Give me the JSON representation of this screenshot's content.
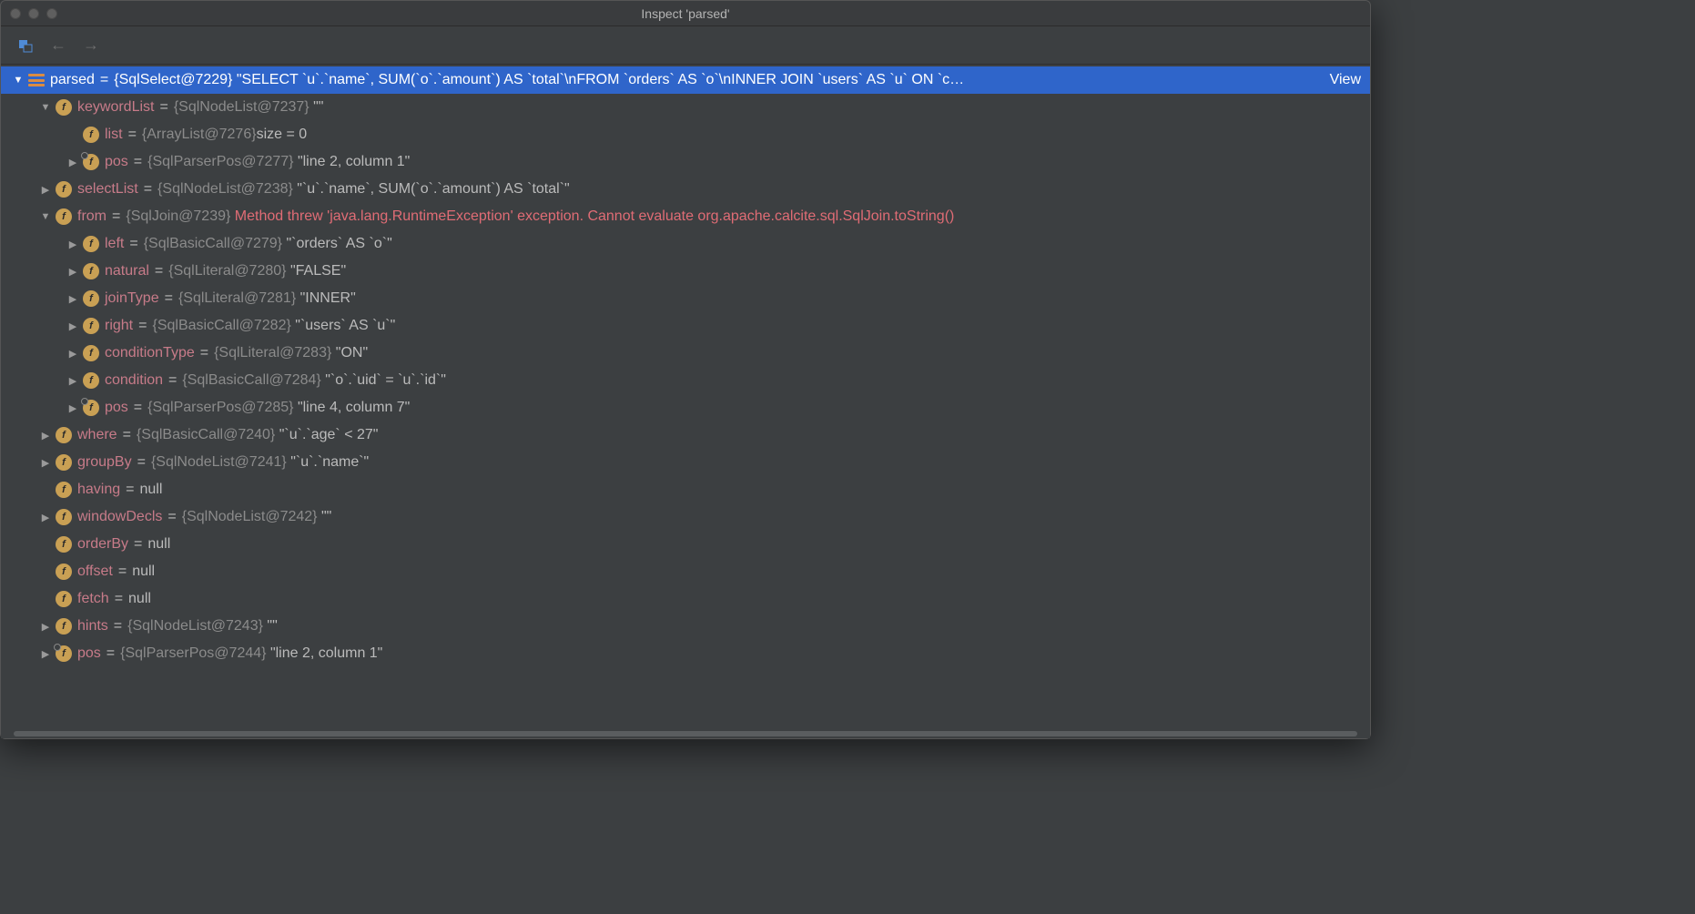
{
  "window": {
    "title": "Inspect 'parsed'"
  },
  "root": {
    "name": "parsed",
    "type": "{SqlSelect@7229}",
    "value": "\"SELECT `u`.`name`, SUM(`o`.`amount`) AS `total`\\nFROM `orders` AS `o`\\nINNER JOIN `users` AS `u` ON `c…",
    "viewLabel": "View"
  },
  "nodes": {
    "keywordList": {
      "name": "keywordList",
      "type": "{SqlNodeList@7237}",
      "value": "\"\""
    },
    "list": {
      "name": "list",
      "type": "{ArrayList@7276}",
      "value": " size = 0"
    },
    "pos1": {
      "name": "pos",
      "type": "{SqlParserPos@7277}",
      "value": "\"line 2, column 1\""
    },
    "selectList": {
      "name": "selectList",
      "type": "{SqlNodeList@7238}",
      "value": "\"`u`.`name`, SUM(`o`.`amount`) AS `total`\""
    },
    "from": {
      "name": "from",
      "type": "{SqlJoin@7239}",
      "value": "Method threw 'java.lang.RuntimeException' exception. Cannot evaluate org.apache.calcite.sql.SqlJoin.toString()"
    },
    "left": {
      "name": "left",
      "type": "{SqlBasicCall@7279}",
      "value": "\"`orders` AS `o`\""
    },
    "natural": {
      "name": "natural",
      "type": "{SqlLiteral@7280}",
      "value": "\"FALSE\""
    },
    "joinType": {
      "name": "joinType",
      "type": "{SqlLiteral@7281}",
      "value": "\"INNER\""
    },
    "right": {
      "name": "right",
      "type": "{SqlBasicCall@7282}",
      "value": "\"`users` AS `u`\""
    },
    "conditionType": {
      "name": "conditionType",
      "type": "{SqlLiteral@7283}",
      "value": "\"ON\""
    },
    "condition": {
      "name": "condition",
      "type": "{SqlBasicCall@7284}",
      "value": "\"`o`.`uid` = `u`.`id`\""
    },
    "pos2": {
      "name": "pos",
      "type": "{SqlParserPos@7285}",
      "value": "\"line 4, column 7\""
    },
    "where": {
      "name": "where",
      "type": "{SqlBasicCall@7240}",
      "value": "\"`u`.`age` < 27\""
    },
    "groupBy": {
      "name": "groupBy",
      "type": "{SqlNodeList@7241}",
      "value": "\"`u`.`name`\""
    },
    "having": {
      "name": "having",
      "type": "",
      "value": "null"
    },
    "windowDecls": {
      "name": "windowDecls",
      "type": "{SqlNodeList@7242}",
      "value": "\"\""
    },
    "orderBy": {
      "name": "orderBy",
      "type": "",
      "value": "null"
    },
    "offset": {
      "name": "offset",
      "type": "",
      "value": "null"
    },
    "fetch": {
      "name": "fetch",
      "type": "",
      "value": "null"
    },
    "hints": {
      "name": "hints",
      "type": "{SqlNodeList@7243}",
      "value": "\"\""
    },
    "pos3": {
      "name": "pos",
      "type": "{SqlParserPos@7244}",
      "value": "\"line 2, column 1\""
    }
  }
}
